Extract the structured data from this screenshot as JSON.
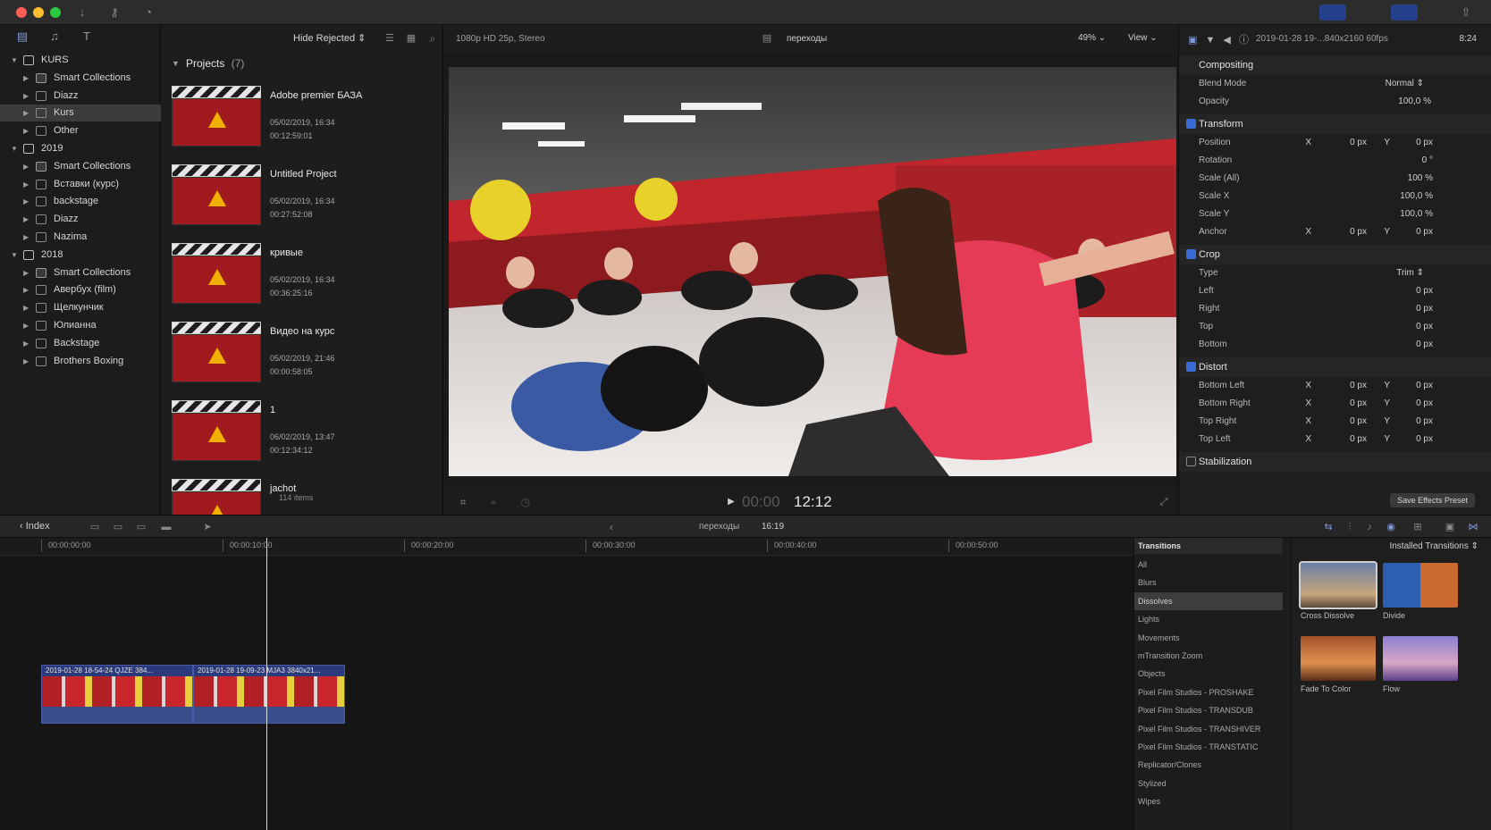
{
  "toolbar": {
    "hide_rejected": "Hide Rejected ⇕"
  },
  "library": {
    "items": [
      {
        "label": "KURS",
        "level": 0,
        "type": "library",
        "expanded": true
      },
      {
        "label": "Smart Collections",
        "level": 1,
        "type": "folder"
      },
      {
        "label": "Diazz",
        "level": 1,
        "type": "event"
      },
      {
        "label": "Kurs",
        "level": 1,
        "type": "event",
        "selected": true
      },
      {
        "label": "Other",
        "level": 1,
        "type": "event"
      },
      {
        "label": "2019",
        "level": 0,
        "type": "library",
        "expanded": true
      },
      {
        "label": "Smart Collections",
        "level": 1,
        "type": "folder"
      },
      {
        "label": "Вставки (курс)",
        "level": 1,
        "type": "event"
      },
      {
        "label": "backstage",
        "level": 1,
        "type": "event"
      },
      {
        "label": "Diazz",
        "level": 1,
        "type": "event"
      },
      {
        "label": "Nazima",
        "level": 1,
        "type": "event"
      },
      {
        "label": "2018",
        "level": 0,
        "type": "library",
        "expanded": true
      },
      {
        "label": "Smart Collections",
        "level": 1,
        "type": "folder"
      },
      {
        "label": "Авербух (film)",
        "level": 1,
        "type": "event"
      },
      {
        "label": "Щелкунчик",
        "level": 1,
        "type": "event"
      },
      {
        "label": "Юлианна",
        "level": 1,
        "type": "event"
      },
      {
        "label": "Backstage",
        "level": 1,
        "type": "event"
      },
      {
        "label": "Brothers Boxing",
        "level": 1,
        "type": "event"
      }
    ]
  },
  "browser": {
    "section_title": "Projects",
    "section_count": "(7)",
    "items_count": "114 items",
    "projects": [
      {
        "name": "Adobe premier БАЗА",
        "date": "05/02/2019, 16:34",
        "duration": "00:12:59:01"
      },
      {
        "name": "Untitled Project",
        "date": "05/02/2019, 16:34",
        "duration": "00:27:52:08"
      },
      {
        "name": "кривые",
        "date": "05/02/2019, 16:34",
        "duration": "00:36:25:16"
      },
      {
        "name": "Видео на курс",
        "date": "05/02/2019, 21:46",
        "duration": "00:00:58:05"
      },
      {
        "name": "1",
        "date": "06/02/2019, 13:47",
        "duration": "00:12:34:12"
      },
      {
        "name": "jachot",
        "date": "",
        "duration": ""
      }
    ]
  },
  "viewer": {
    "format": "1080p HD 25p, Stereo",
    "project_name": "переходы",
    "zoom": "49%",
    "view_label": "View",
    "timecode_dim": "00:00",
    "timecode": "12:12"
  },
  "inspector": {
    "header_title": "2019-01-28 19-...840x2160 60fps",
    "header_duration": "8:24",
    "compositing": "Compositing",
    "blend_mode_label": "Blend Mode",
    "blend_mode_value": "Normal ⇕",
    "opacity_label": "Opacity",
    "opacity_value": "100,0 %",
    "transform": "Transform",
    "position_label": "Position",
    "rotation_label": "Rotation",
    "rotation_value": "0 °",
    "scale_all_label": "Scale (All)",
    "scale_all_value": "100 %",
    "scale_x_label": "Scale X",
    "scale_x_value": "100,0 %",
    "scale_y_label": "Scale Y",
    "scale_y_value": "100,0 %",
    "anchor_label": "Anchor",
    "crop": "Crop",
    "type_label": "Type",
    "type_value": "Trim ⇕",
    "left_label": "Left",
    "right_label": "Right",
    "top_label": "Top",
    "bottom_label": "Bottom",
    "distort": "Distort",
    "bottom_left_label": "Bottom Left",
    "bottom_right_label": "Bottom Right",
    "top_right_label": "Top Right",
    "top_left_label": "Top Left",
    "stabilization": "Stabilization",
    "zero_px": "0 px",
    "x_label": "X",
    "y_label": "Y",
    "save_preset": "Save Effects Preset"
  },
  "timeline_toolbar": {
    "index_label": "Index",
    "project_name": "переходы",
    "duration": "16:19"
  },
  "timeline": {
    "ruler_ticks": [
      "00:00:00:00",
      "00:00:10:00",
      "00:00:20:00",
      "00:00:30:00",
      "00:00:40:00",
      "00:00:50:00"
    ],
    "clips": [
      {
        "title": "2019-01-28 18-54-24 QJZE 384..."
      },
      {
        "title": "2019-01-28 19-09-23 MJA3 3840x21..."
      }
    ]
  },
  "transitions": {
    "title": "Transitions",
    "installed": "Installed Transitions ⇕",
    "categories": [
      "All",
      "Blurs",
      "Dissolves",
      "Lights",
      "Movements",
      "mTransition Zoom",
      "Objects",
      "Pixel Film Studios - PROSHAKE",
      "Pixel Film Studios - TRANSDUB",
      "Pixel Film Studios - TRANSHIVER",
      "Pixel Film Studios - TRANSTATIC",
      "Replicator/Clones",
      "Stylized",
      "Wipes"
    ],
    "selected_category": "Dissolves",
    "thumbs": [
      {
        "label": "Cross Dissolve"
      },
      {
        "label": "Divide"
      },
      {
        "label": "Fade To Color"
      },
      {
        "label": "Flow"
      }
    ]
  },
  "colors": {
    "accent": "#3b6bd6",
    "clip": "#2b3a7a"
  }
}
